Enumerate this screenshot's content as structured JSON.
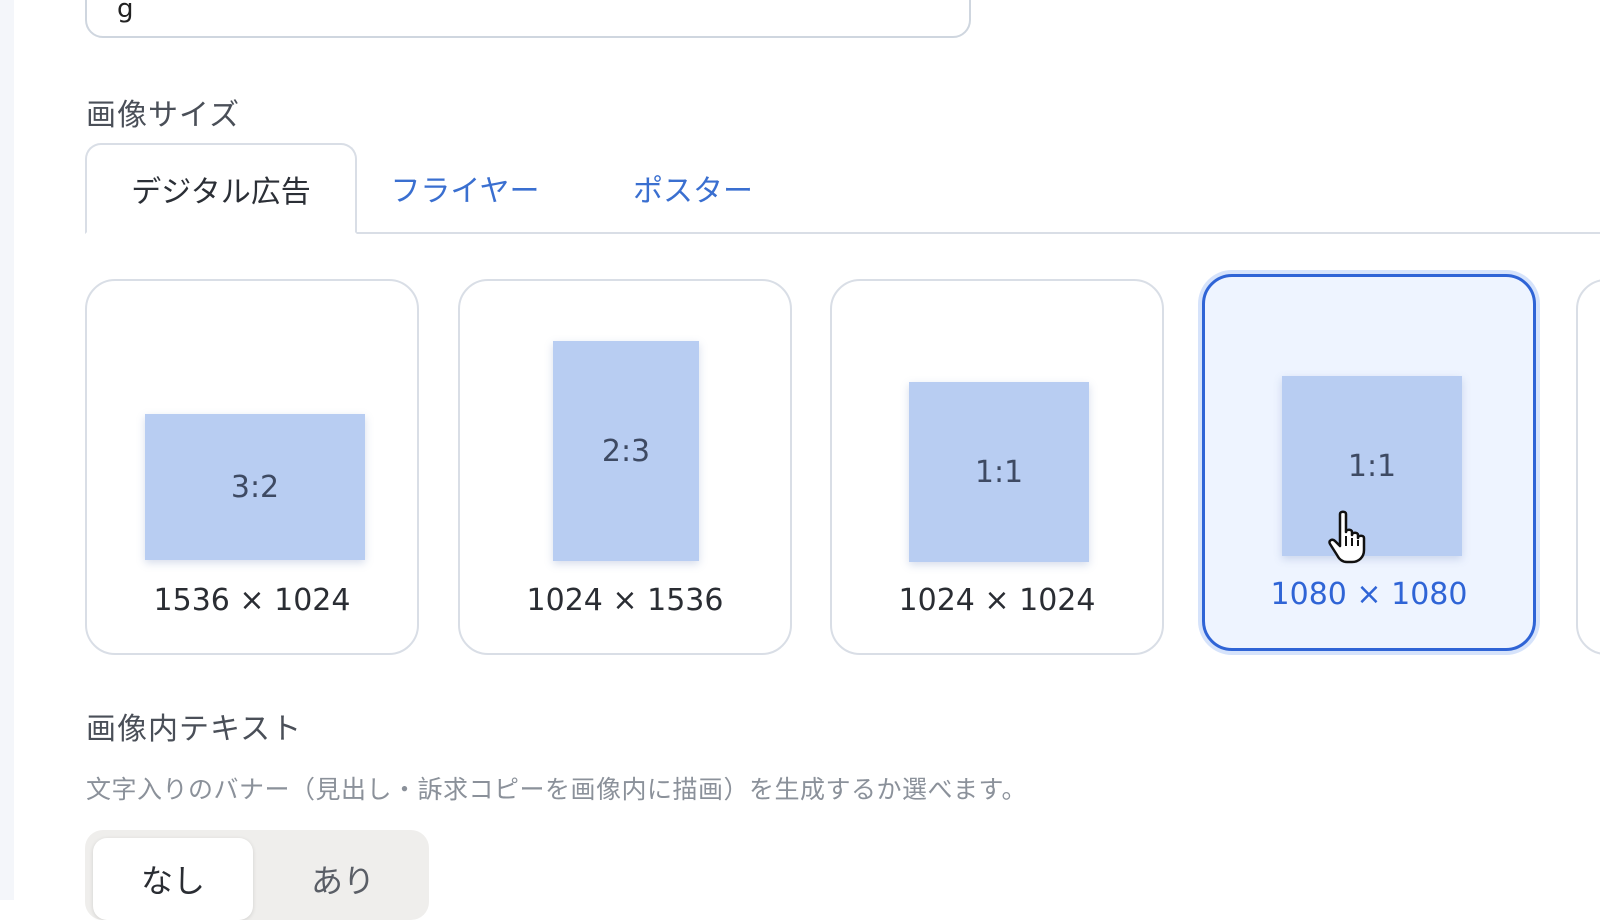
{
  "prompt_field": {
    "visible_text": "g"
  },
  "image_size": {
    "label": "画像サイズ",
    "tabs": [
      {
        "label": "デジタル広告",
        "active": true
      },
      {
        "label": "フライヤー",
        "active": false
      },
      {
        "label": "ポスター",
        "active": false
      }
    ],
    "options": [
      {
        "ratio": "3:2",
        "dimensions": "1536 × 1024",
        "selected": false
      },
      {
        "ratio": "2:3",
        "dimensions": "1024 × 1536",
        "selected": false
      },
      {
        "ratio": "1:1",
        "dimensions": "1024 × 1024",
        "selected": false
      },
      {
        "ratio": "1:1",
        "dimensions": "1080 × 1080",
        "selected": true
      }
    ]
  },
  "in_image_text": {
    "label": "画像内テキスト",
    "hint": "文字入りのバナー（見出し・訴求コピーを画像内に描画）を生成するか選べます。",
    "options": [
      {
        "label": "なし",
        "active": true
      },
      {
        "label": "あり",
        "active": false
      }
    ]
  },
  "colors": {
    "accent": "#2f64d6",
    "selected_card_bg": "#eef4ff",
    "preview_fill": "#b8cdf2",
    "tab_link": "#3a6fd0"
  },
  "icons": {
    "cursor": "hand-pointer-icon"
  }
}
